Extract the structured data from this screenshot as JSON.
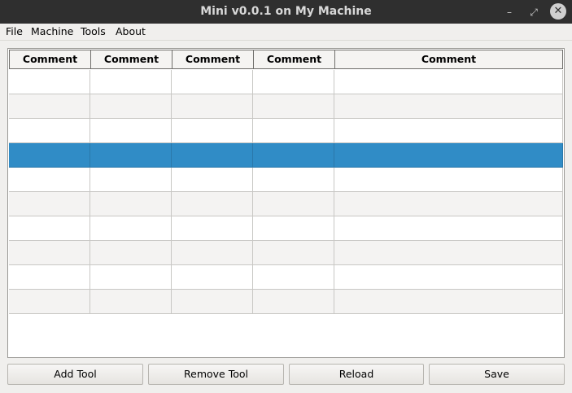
{
  "window": {
    "title": "Mini v0.0.1 on My Machine",
    "controls": {
      "minimize": "–",
      "maximize": "⤢",
      "close": "✕"
    }
  },
  "menu": {
    "items": [
      "File",
      "Machine",
      "Tools",
      "About"
    ]
  },
  "table": {
    "headers": [
      "Comment",
      "Comment",
      "Comment",
      "Comment",
      "Comment"
    ],
    "row_count": 10,
    "selected_row": 3,
    "rows": [
      [
        "",
        "",
        "",
        "",
        ""
      ],
      [
        "",
        "",
        "",
        "",
        ""
      ],
      [
        "",
        "",
        "",
        "",
        ""
      ],
      [
        "",
        "",
        "",
        "",
        ""
      ],
      [
        "",
        "",
        "",
        "",
        ""
      ],
      [
        "",
        "",
        "",
        "",
        ""
      ],
      [
        "",
        "",
        "",
        "",
        ""
      ],
      [
        "",
        "",
        "",
        "",
        ""
      ],
      [
        "",
        "",
        "",
        "",
        ""
      ],
      [
        "",
        "",
        "",
        "",
        ""
      ]
    ]
  },
  "buttons": {
    "add": "Add Tool",
    "remove": "Remove Tool",
    "reload": "Reload",
    "save": "Save"
  },
  "colors": {
    "titlebar": "#2f2f2f",
    "selection": "#308cc6",
    "window_bg": "#f0efed"
  }
}
